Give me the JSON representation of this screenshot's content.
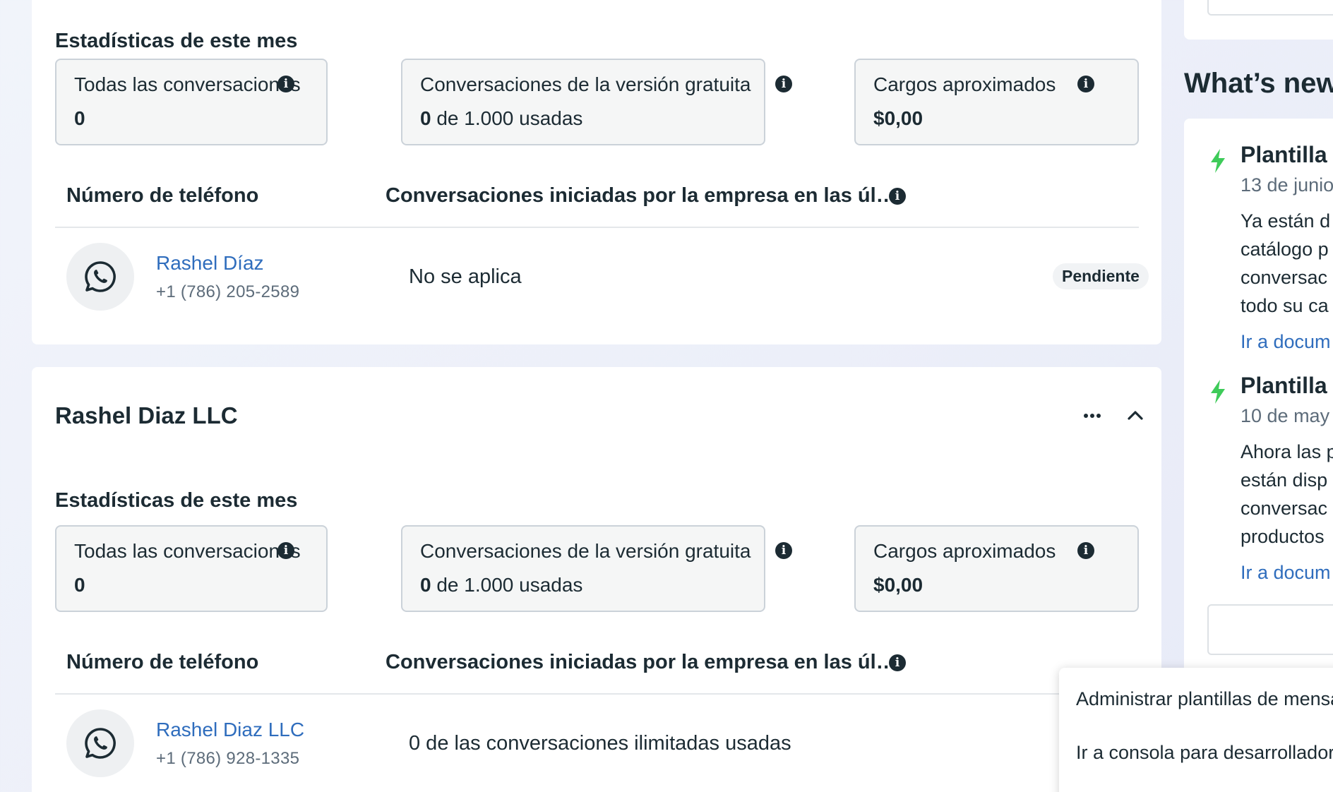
{
  "card1": {
    "stats_title": "Estadísticas de este mes",
    "stats": [
      {
        "label": "Todas las conversaciones",
        "value_bold": "0",
        "value_rest": ""
      },
      {
        "label": "Conversaciones de la versión gratuita",
        "value_bold": "0",
        "value_rest": " de 1.000 usadas"
      },
      {
        "label": "Cargos aproximados",
        "value_bold": "$0,00",
        "value_rest": ""
      }
    ],
    "table": {
      "col_phone": "Número de teléfono",
      "col_conversations": "Conversaciones iniciadas por la empresa en las úl…"
    },
    "row": {
      "name": "Rashel Díaz",
      "phone": "+1 (786) 205-2589",
      "conversations": "No se aplica",
      "status": "Pendiente"
    }
  },
  "card2": {
    "title": "Rashel Diaz LLC",
    "stats_title": "Estadísticas de este mes",
    "stats": [
      {
        "label": "Todas las conversaciones",
        "value_bold": "0",
        "value_rest": ""
      },
      {
        "label": "Conversaciones de la versión gratuita",
        "value_bold": "0",
        "value_rest": " de 1.000 usadas"
      },
      {
        "label": "Cargos aproximados",
        "value_bold": "$0,00",
        "value_rest": ""
      }
    ],
    "table": {
      "col_phone": "Número de teléfono",
      "col_conversations": "Conversaciones iniciadas por la empresa en las úl…"
    },
    "row": {
      "name": "Rashel Diaz LLC",
      "phone": "+1 (786) 928-1335",
      "conversations": "0 de las conversaciones ilimitadas usadas"
    }
  },
  "right_panel": {
    "whats_new": "What’s new",
    "items": [
      {
        "title": "Plantilla",
        "date": "13 de junio",
        "body": [
          "Ya están d",
          "catálogo p",
          "conversac",
          "todo su ca"
        ],
        "link": "Ir a docum"
      },
      {
        "title": "Plantilla",
        "date": "10 de may",
        "body": [
          "Ahora las p",
          "están disp",
          "conversac",
          "productos"
        ],
        "link": "Ir a docum"
      }
    ]
  },
  "menu": {
    "items": [
      "Administrar plantillas de mensajes",
      "Ir a consola para desarrolladores"
    ]
  },
  "colors": {
    "link": "#2f6dbd",
    "text": "#1c2b33",
    "bolt": "#3ecb59"
  },
  "icons": [
    "info-icon",
    "whatsapp-icon",
    "more-icon",
    "chevron-up-icon",
    "bolt-icon"
  ]
}
